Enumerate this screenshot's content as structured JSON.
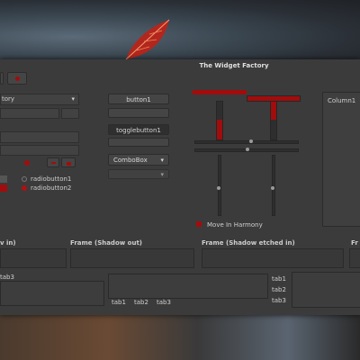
{
  "window": {
    "title": "The Widget Factory"
  },
  "left": {
    "combo_partial": "tory",
    "radios": [
      "radiobutton1",
      "radiobutton2"
    ]
  },
  "middle": {
    "button1": "button1",
    "togglebutton1": "togglebutton1",
    "combobox": "ComboBox"
  },
  "sliders": {
    "move_in_harmony": "Move In Harmony"
  },
  "list": {
    "column1": "Column1"
  },
  "frames": [
    {
      "label": "v in)"
    },
    {
      "label": "Frame (Shadow out)"
    },
    {
      "label": "Frame (Shadow etched in)"
    },
    {
      "label": "Fr"
    }
  ],
  "tabs": {
    "left_tab": "tab3",
    "bottom": [
      "tab1",
      "tab2",
      "tab3"
    ],
    "right": [
      "tab1",
      "tab2",
      "tab3"
    ]
  },
  "colors": {
    "accent": "#a10d0d",
    "window_bg": "#3b3b3b"
  }
}
